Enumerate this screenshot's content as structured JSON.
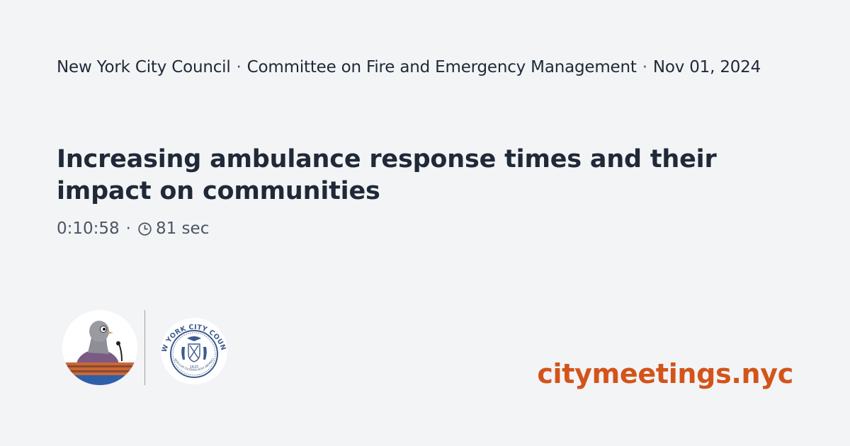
{
  "meta": {
    "organization": "New York City Council",
    "committee": "Committee on Fire and Emergency Management",
    "date": "Nov 01, 2024",
    "separator": "·"
  },
  "title": "Increasing ambulance response times and their impact on communities",
  "timing": {
    "timestamp": "0:10:58",
    "separator": "·",
    "duration": "81 sec",
    "duration_icon": "clock-icon"
  },
  "logos": {
    "mascot_icon": "pigeon-at-podium-icon",
    "seal_text": "NEW YORK CITY COUNCIL",
    "seal_motto": "SIGILLUM CIVITATIS NOVI EBORACI",
    "seal_year": "1625"
  },
  "site_name": "citymeetings.nyc",
  "colors": {
    "background": "#f3f4f6",
    "text": "#1f2937",
    "muted": "#4b5563",
    "accent": "#d3541a",
    "seal_blue": "#3c5a8c"
  }
}
